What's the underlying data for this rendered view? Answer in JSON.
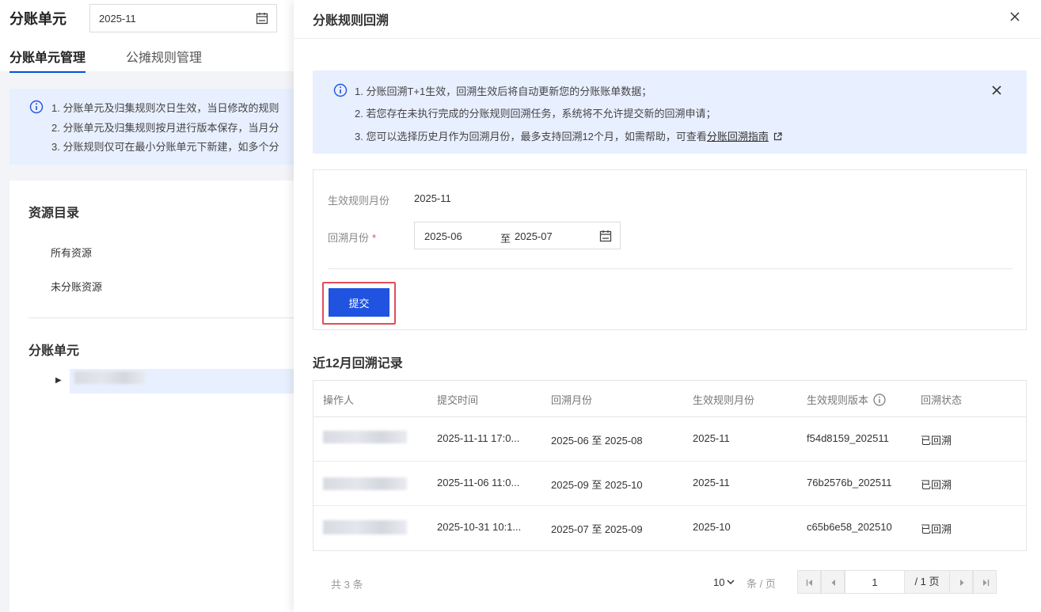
{
  "background": {
    "title": "分账单元",
    "month_value": "2025-11",
    "tabs": [
      {
        "label": "分账单元管理",
        "active": true
      },
      {
        "label": "公摊规则管理",
        "active": false
      }
    ],
    "notices": [
      "1. 分账单元及归集规则次日生效，当日修改的规则",
      "2. 分账单元及归集规则按月进行版本保存，当月分",
      "3. 分账规则仅可在最小分账单元下新建，如多个分"
    ],
    "resource_heading": "资源目录",
    "resource_items": [
      "所有资源",
      "未分账资源"
    ],
    "unit_heading": "分账单元"
  },
  "drawer": {
    "title": "分账规则回溯",
    "alert": {
      "line1": "1. 分账回溯T+1生效，回溯生效后将自动更新您的分账账单数据；",
      "line2": "2. 若您存在未执行完成的分账规则回溯任务，系统将不允许提交新的回溯申请；",
      "line3_prefix": "3. 您可以选择历史月作为回溯月份，最多支持回溯12个月，如需帮助，可查看",
      "line3_link": "分账回溯指南"
    },
    "form": {
      "effective_label": "生效规则月份",
      "effective_value": "2025-11",
      "range_label": "回溯月份",
      "required_mark": "*",
      "range_from": "2025-06",
      "range_sep": "至",
      "range_to": "2025-07",
      "submit_label": "提交"
    },
    "records": {
      "title": "近12月回溯记录",
      "columns": [
        "操作人",
        "提交时间",
        "回溯月份",
        "生效规则月份",
        "生效规则版本",
        "回溯状态"
      ],
      "rows": [
        {
          "submit_time": "2025-11-11 17:0...",
          "range": "2025-06 至 2025-08",
          "effective_month": "2025-11",
          "version": "f54d8159_202511",
          "status": "已回溯"
        },
        {
          "submit_time": "2025-11-06 11:0...",
          "range": "2025-09 至 2025-10",
          "effective_month": "2025-11",
          "version": "76b2576b_202511",
          "status": "已回溯"
        },
        {
          "submit_time": "2025-10-31 10:1...",
          "range": "2025-07 至 2025-09",
          "effective_month": "2025-10",
          "version": "c65b6e58_202510",
          "status": "已回溯"
        }
      ]
    },
    "pagination": {
      "total_text": "共 3 条",
      "page_size": "10",
      "page_size_unit": "条 / 页",
      "current_page": "1",
      "total_pages_text": "/ 1 页"
    }
  },
  "colors": {
    "primary": "#1f53e0",
    "highlight": "#e34d59",
    "info_bg": "#e8efff"
  },
  "icons": [
    "calendar-icon",
    "info-icon",
    "close-icon",
    "external-link-icon",
    "help-circle-icon",
    "chevron-down-icon",
    "first-page-icon",
    "prev-page-icon",
    "next-page-icon",
    "last-page-icon",
    "caret-right-icon"
  ]
}
